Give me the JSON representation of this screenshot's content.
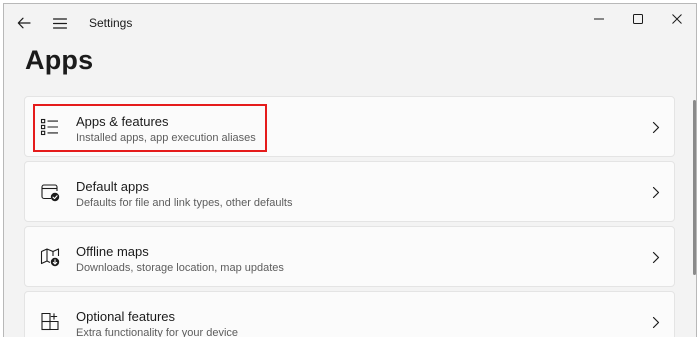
{
  "titlebar": {
    "title": "Settings",
    "back_icon": "back-arrow-icon",
    "menu_icon": "hamburger-menu-icon",
    "window_controls": [
      "minimize",
      "maximize",
      "close"
    ]
  },
  "page": {
    "title": "Apps"
  },
  "items": [
    {
      "title": "Apps & features",
      "subtitle": "Installed apps, app execution aliases",
      "icon": "apps-list-icon",
      "highlighted": true
    },
    {
      "title": "Default apps",
      "subtitle": "Defaults for file and link types, other defaults",
      "icon": "default-apps-icon"
    },
    {
      "title": "Offline maps",
      "subtitle": "Downloads, storage location, map updates",
      "icon": "offline-map-icon"
    },
    {
      "title": "Optional features",
      "subtitle": "Extra functionality for your device",
      "icon": "optional-features-icon"
    }
  ],
  "colors": {
    "highlight_border": "#e51b1b",
    "background": "#f3f3f3",
    "card": "#fbfbfb"
  }
}
